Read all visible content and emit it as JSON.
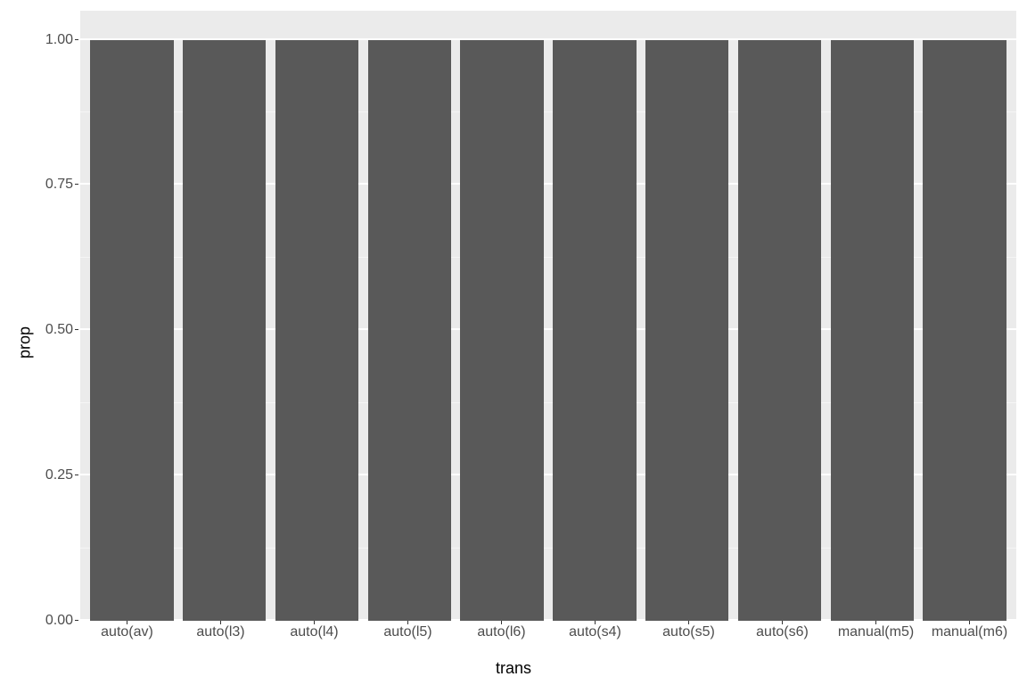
{
  "chart_data": {
    "type": "bar",
    "categories": [
      "auto(av)",
      "auto(l3)",
      "auto(l4)",
      "auto(l5)",
      "auto(l6)",
      "auto(s4)",
      "auto(s5)",
      "auto(s6)",
      "manual(m5)",
      "manual(m6)"
    ],
    "values": [
      1.0,
      1.0,
      1.0,
      1.0,
      1.0,
      1.0,
      1.0,
      1.0,
      1.0,
      1.0
    ],
    "title": "",
    "xlabel": "trans",
    "ylabel": "prop",
    "ylim": [
      0,
      1.05
    ],
    "y_ticks": [
      0.0,
      0.25,
      0.5,
      0.75,
      1.0
    ],
    "y_tick_labels": [
      "0.00",
      "0.25",
      "0.50",
      "0.75",
      "1.00"
    ],
    "bar_fill": "#595959",
    "panel_bg": "#ebebeb"
  }
}
